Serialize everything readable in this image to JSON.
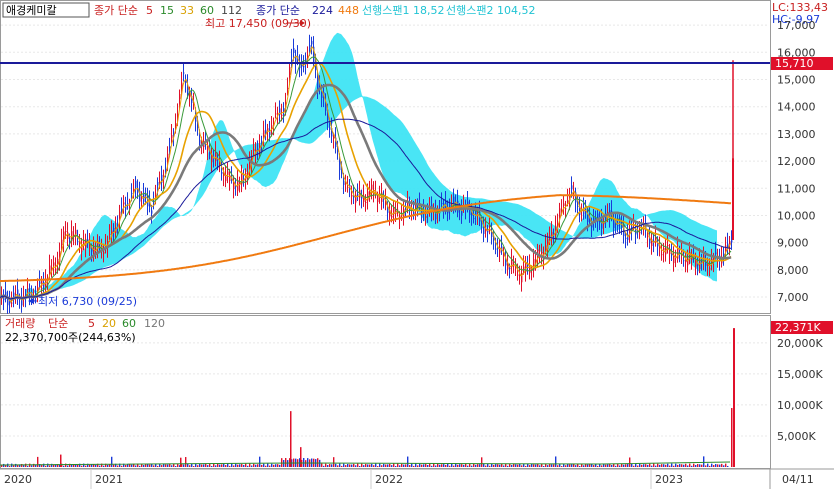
{
  "chart_data": [
    {
      "type": "line",
      "stock_name": "애경케미칼",
      "legend": {
        "price_prefix": "종가 단순",
        "ma_periods": [
          "5",
          "15",
          "33",
          "60",
          "112"
        ],
        "close_prefix": "종가 단순",
        "close_periods": [
          "224",
          "448"
        ],
        "span1": "선행스팬1 18,52",
        "span2": "선행스팬2 104,52"
      },
      "annotations": {
        "high": "최고 17,450 (09/30)",
        "low": "최저 6,730 (09/25)",
        "lc": "LC:133,43",
        "hc": "HC:-9,97",
        "last_price_tag": "15,710"
      },
      "y_ticks": [
        "17,000",
        "16,000",
        "15,000",
        "14,000",
        "13,000",
        "12,000",
        "11,000",
        "10,000",
        "9,000",
        "8,000",
        "7,000"
      ],
      "ylim": [
        6450,
        17850
      ],
      "horizontal_line": 15710,
      "series_colors": {
        "ma5": "#e8a100",
        "ma15": "#3a9a3a",
        "ma33": "#e8a100",
        "ma60": "#7a7a7a",
        "ma112": "#1a1a9a",
        "ma224": "#1a1a9a",
        "ma448": "#f07a10",
        "cloud": "#3fe4f4",
        "up": "#e0102a",
        "down": "#1a3ad8",
        "hline": "#1a1a9a"
      }
    },
    {
      "type": "bar",
      "legend": {
        "title": "거래량",
        "prefix": "단순",
        "periods": [
          "5",
          "20",
          "60",
          "120"
        ]
      },
      "volume_text": "22,370,700주(244,63%)",
      "last_tag": "22,371K",
      "y_ticks": [
        "20,000K",
        "15,000K",
        "10,000K",
        "5,000K"
      ],
      "ylim": [
        0,
        24000
      ],
      "peak_volume_k": 22371
    }
  ],
  "x_axis": {
    "labels": [
      "2020",
      "2021",
      "2022",
      "2023",
      "04/11"
    ]
  }
}
